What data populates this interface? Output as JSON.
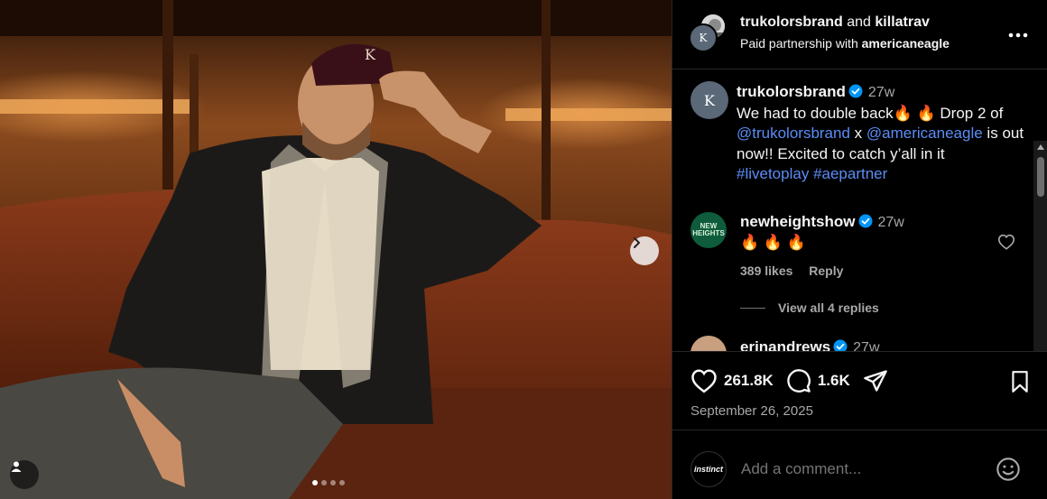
{
  "header": {
    "user1": "trukolorsbrand",
    "and_text": "and",
    "user2": "killatrav",
    "partnership_prefix": "Paid partnership with",
    "partner": "americaneagle",
    "avatar_monogram": "K",
    "more_icon": "more-horizontal-icon"
  },
  "caption": {
    "username": "trukolorsbrand",
    "time": "27w",
    "text_start": "We had to double back",
    "text_drop": "Drop 2 of",
    "mention1": "@trukolorsbrand",
    "x": "x",
    "mention2": "@americaneagle",
    "is": "is",
    "text_end": "out now!! Excited to catch y’all in it",
    "hashtag1": "#livetoplay",
    "hashtag2": "#aepartner",
    "emoji": "🔥"
  },
  "comments": [
    {
      "username": "newheightshow",
      "time": "27w",
      "text": "🔥 🔥 🔥",
      "likes": "389 likes",
      "reply": "Reply",
      "view_replies": "View all 4 replies",
      "avatar_text": "NEW HEIGHTS"
    },
    {
      "username": "erinandrews",
      "time": "27w"
    }
  ],
  "actions": {
    "likes": "261.8K",
    "comments": "1.6K",
    "date": "September 26, 2025"
  },
  "add_comment": {
    "placeholder": "Add a comment...",
    "avatar_text": "instinct"
  },
  "carousel": {
    "current": 1,
    "total": 4
  },
  "colors": {
    "link": "#5b8df6",
    "verified": "#0095f6",
    "background": "#000000"
  }
}
